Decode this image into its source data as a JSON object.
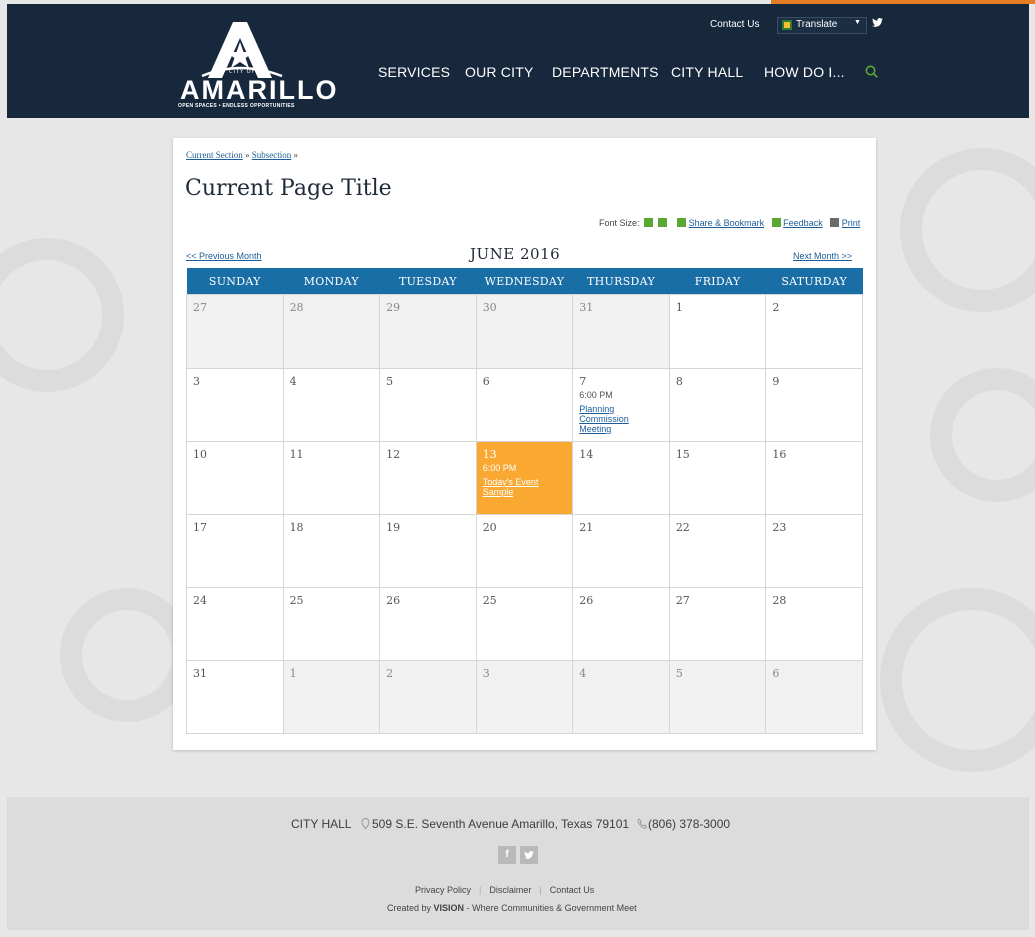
{
  "header": {
    "logo": {
      "word": "AMARILLO",
      "city_of": "CITY OF",
      "tagline": "OPEN SPACES • ENDLESS OPPORTUNITIES"
    },
    "utility": {
      "contact": "Contact Us",
      "translate": "Translate"
    },
    "nav": [
      "SERVICES",
      "OUR CITY",
      "DEPARTMENTS",
      "CITY HALL",
      "HOW DO I..."
    ],
    "colors": {
      "header_bg": "#17283d",
      "accent": "#e57c24",
      "search_icon": "#5aa832"
    }
  },
  "breadcrumb": {
    "current_section": "Current Section",
    "subsection": "Subsection",
    "separator": "»"
  },
  "page_title": "Current Page Title",
  "tools": {
    "font_size": "Font Size:",
    "share": "Share & Bookmark",
    "feedback": "Feedback",
    "print": "Print"
  },
  "calendar": {
    "prev": "<< Previous Month",
    "next": "Next Month >>",
    "month": "JUNE 2016",
    "weekdays": [
      "SUNDAY",
      "MONDAY",
      "TUESDAY",
      "WEDNESDAY",
      "THURSDAY",
      "FRIDAY",
      "SATURDAY"
    ],
    "colors": {
      "header": "#1a6ea6",
      "today": "#f9a832",
      "other_month": "#f1f1f1"
    },
    "weeks": [
      [
        {
          "d": "27",
          "other": true
        },
        {
          "d": "28",
          "other": true
        },
        {
          "d": "29",
          "other": true
        },
        {
          "d": "30",
          "other": true
        },
        {
          "d": "31",
          "other": true
        },
        {
          "d": "1"
        },
        {
          "d": "2"
        }
      ],
      [
        {
          "d": "3"
        },
        {
          "d": "4"
        },
        {
          "d": "5"
        },
        {
          "d": "6"
        },
        {
          "d": "7",
          "time": "6:00 PM",
          "event": "Planning Commission Meeting"
        },
        {
          "d": "8"
        },
        {
          "d": "9"
        }
      ],
      [
        {
          "d": "10"
        },
        {
          "d": "11"
        },
        {
          "d": "12"
        },
        {
          "d": "13",
          "today": true,
          "time": "6:00 PM",
          "event": "Today's Event Sample"
        },
        {
          "d": "14"
        },
        {
          "d": "15"
        },
        {
          "d": "16"
        }
      ],
      [
        {
          "d": "17"
        },
        {
          "d": "18"
        },
        {
          "d": "19"
        },
        {
          "d": "20"
        },
        {
          "d": "21"
        },
        {
          "d": "22"
        },
        {
          "d": "23"
        }
      ],
      [
        {
          "d": "24"
        },
        {
          "d": "25"
        },
        {
          "d": "26"
        },
        {
          "d": "25"
        },
        {
          "d": "26"
        },
        {
          "d": "27"
        },
        {
          "d": "28"
        }
      ],
      [
        {
          "d": "31"
        },
        {
          "d": "1",
          "other": true
        },
        {
          "d": "2",
          "other": true
        },
        {
          "d": "3",
          "other": true
        },
        {
          "d": "4",
          "other": true
        },
        {
          "d": "5",
          "other": true
        },
        {
          "d": "6",
          "other": true
        }
      ]
    ]
  },
  "footer": {
    "label": "CITY HALL",
    "address": "509 S.E. Seventh Avenue Amarillo, Texas 79101",
    "phone": "(806) 378-3000",
    "links": [
      "Privacy Policy",
      "Disclaimer",
      "Contact Us"
    ],
    "credit_prefix": "Created by",
    "credit_brand": "VISION",
    "credit_suffix": "- Where Communities & Government Meet"
  }
}
